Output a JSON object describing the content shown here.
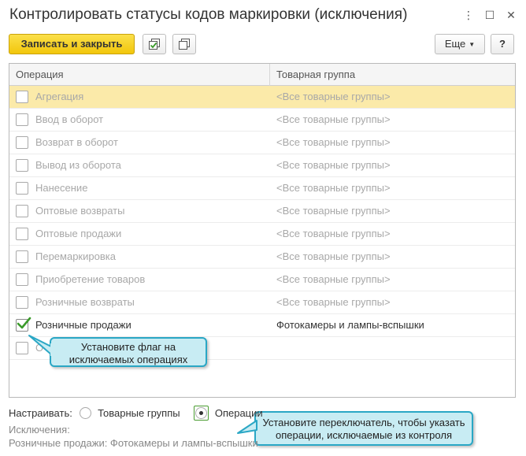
{
  "window": {
    "title": "Контролировать статусы кодов маркировки (исключения)",
    "controls": {
      "more": "⋮",
      "maximize": "☐",
      "close": "✕"
    }
  },
  "toolbar": {
    "save_close_label": "Записать и закрыть",
    "more_label": "Еще",
    "help_label": "?"
  },
  "table": {
    "columns": {
      "operation": "Операция",
      "group": "Товарная группа"
    },
    "rows": [
      {
        "operation": "Агрегация",
        "group": "<Все товарные группы>",
        "checked": false,
        "enabled": false,
        "selected": true
      },
      {
        "operation": "Ввод в оборот",
        "group": "<Все товарные группы>",
        "checked": false,
        "enabled": false,
        "selected": false
      },
      {
        "operation": "Возврат в оборот",
        "group": "<Все товарные группы>",
        "checked": false,
        "enabled": false,
        "selected": false
      },
      {
        "operation": "Вывод из оборота",
        "group": "<Все товарные группы>",
        "checked": false,
        "enabled": false,
        "selected": false
      },
      {
        "operation": "Нанесение",
        "group": "<Все товарные группы>",
        "checked": false,
        "enabled": false,
        "selected": false
      },
      {
        "operation": "Оптовые возвраты",
        "group": "<Все товарные группы>",
        "checked": false,
        "enabled": false,
        "selected": false
      },
      {
        "operation": "Оптовые продажи",
        "group": "<Все товарные группы>",
        "checked": false,
        "enabled": false,
        "selected": false
      },
      {
        "operation": "Перемаркировка",
        "group": "<Все товарные группы>",
        "checked": false,
        "enabled": false,
        "selected": false
      },
      {
        "operation": "Приобретение товаров",
        "group": "<Все товарные группы>",
        "checked": false,
        "enabled": false,
        "selected": false
      },
      {
        "operation": "Розничные возвраты",
        "group": "<Все товарные группы>",
        "checked": false,
        "enabled": false,
        "selected": false
      },
      {
        "operation": "Розничные продажи",
        "group": "Фотокамеры и лампы-вспышки",
        "checked": true,
        "enabled": true,
        "selected": false
      },
      {
        "operation": "О",
        "group": "",
        "checked": false,
        "enabled": false,
        "selected": false
      }
    ]
  },
  "tooltips": {
    "flag": "Установите флаг на исключаемых операциях",
    "switch": "Установите переключатель, чтобы указать операции, исключаемые из контроля"
  },
  "settings": {
    "label": "Настраивать:",
    "option_groups": "Товарные группы",
    "option_operations": "Операции",
    "selected": "operations"
  },
  "exceptions": {
    "label": "Исключения:",
    "value": "Розничные продажи: Фотокамеры и лампы-вспышки"
  },
  "colors": {
    "accent_yellow": "#f2c60b",
    "selected_row": "#fbeaa9",
    "tooltip_bg": "#c8ecf3",
    "tooltip_border": "#2aa7c5",
    "check_green": "#3a9a2a"
  }
}
